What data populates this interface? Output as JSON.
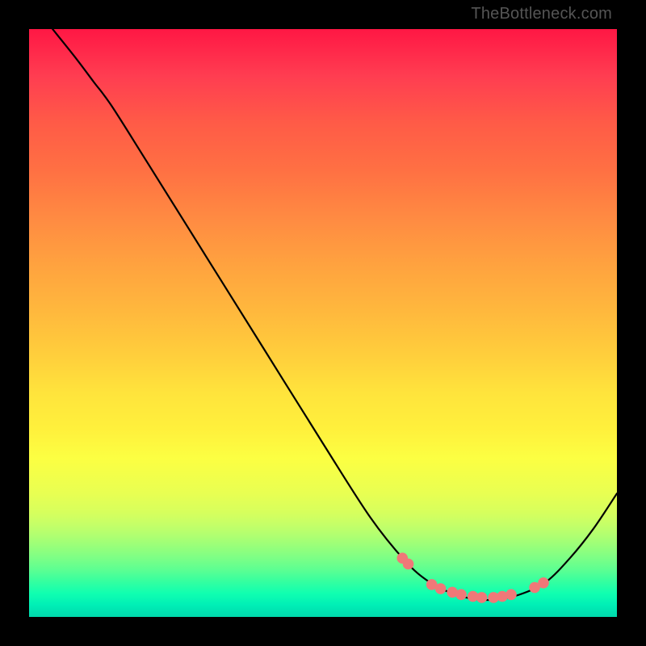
{
  "watermark": "TheBottleneck.com",
  "colors": {
    "background": "#000000",
    "curve_stroke": "#000000",
    "dot_fill": "#f07878"
  },
  "chart_data": {
    "type": "line",
    "title": "",
    "xlabel": "",
    "ylabel": "",
    "xlim": [
      0,
      100
    ],
    "ylim": [
      0,
      100
    ],
    "grid": false,
    "note": "Values estimated from pixel positions in a 100x100 normalized space; y is inverted (0 at bottom, 100 at top). Curve descends from upper-left toward a trough near x≈80, y≈3, then rises toward upper-right.",
    "series": [
      {
        "name": "curve",
        "x": [
          4,
          8,
          11,
          14,
          20,
          30,
          40,
          50,
          58,
          64,
          68,
          72,
          76,
          80,
          84,
          88,
          92,
          96,
          100
        ],
        "y": [
          100,
          95,
          91,
          87,
          77.5,
          61.5,
          45.5,
          29.5,
          17,
          9.5,
          6,
          4,
          3,
          3,
          4,
          6,
          10,
          15,
          21
        ]
      },
      {
        "name": "dots",
        "x": [
          63.5,
          64.5,
          68.5,
          70,
          72,
          73.5,
          75.5,
          77,
          79,
          80.5,
          82,
          86,
          87.5
        ],
        "y": [
          10,
          9,
          5.5,
          4.8,
          4.2,
          3.8,
          3.5,
          3.3,
          3.3,
          3.5,
          3.8,
          5,
          5.8
        ]
      }
    ]
  }
}
